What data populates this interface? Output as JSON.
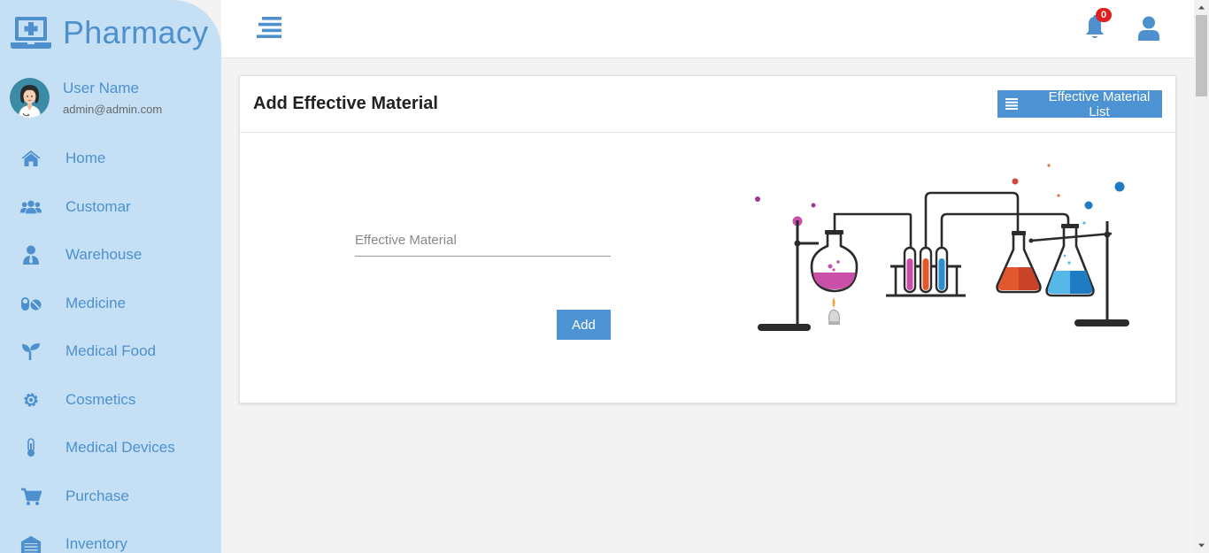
{
  "brand": {
    "name": "Pharmacy",
    "icon": "laptop-medical-icon"
  },
  "user": {
    "name": "User Name",
    "email": "admin@admin.com"
  },
  "sidebar": {
    "items": [
      {
        "label": "Home",
        "icon": "home-icon"
      },
      {
        "label": "Customar",
        "icon": "users-icon"
      },
      {
        "label": "Warehouse",
        "icon": "user-tie-icon"
      },
      {
        "label": "Medicine",
        "icon": "pills-icon"
      },
      {
        "label": "Medical Food",
        "icon": "seedling-icon"
      },
      {
        "label": "Cosmetics",
        "icon": "gear-icon"
      },
      {
        "label": "Medical Devices",
        "icon": "thermometer-icon"
      },
      {
        "label": "Purchase",
        "icon": "cart-icon"
      },
      {
        "label": "Inventory",
        "icon": "warehouse-icon"
      }
    ]
  },
  "topbar": {
    "notification_count": "0"
  },
  "card": {
    "title": "Add Effective Material",
    "list_button_label": "Effective Material List",
    "form": {
      "field_placeholder": "Effective Material",
      "field_value": "",
      "submit_label": "Add"
    }
  },
  "colors": {
    "accent": "#4d93d3",
    "sidebar_bg": "#c5e0f5",
    "badge": "#e02020"
  }
}
